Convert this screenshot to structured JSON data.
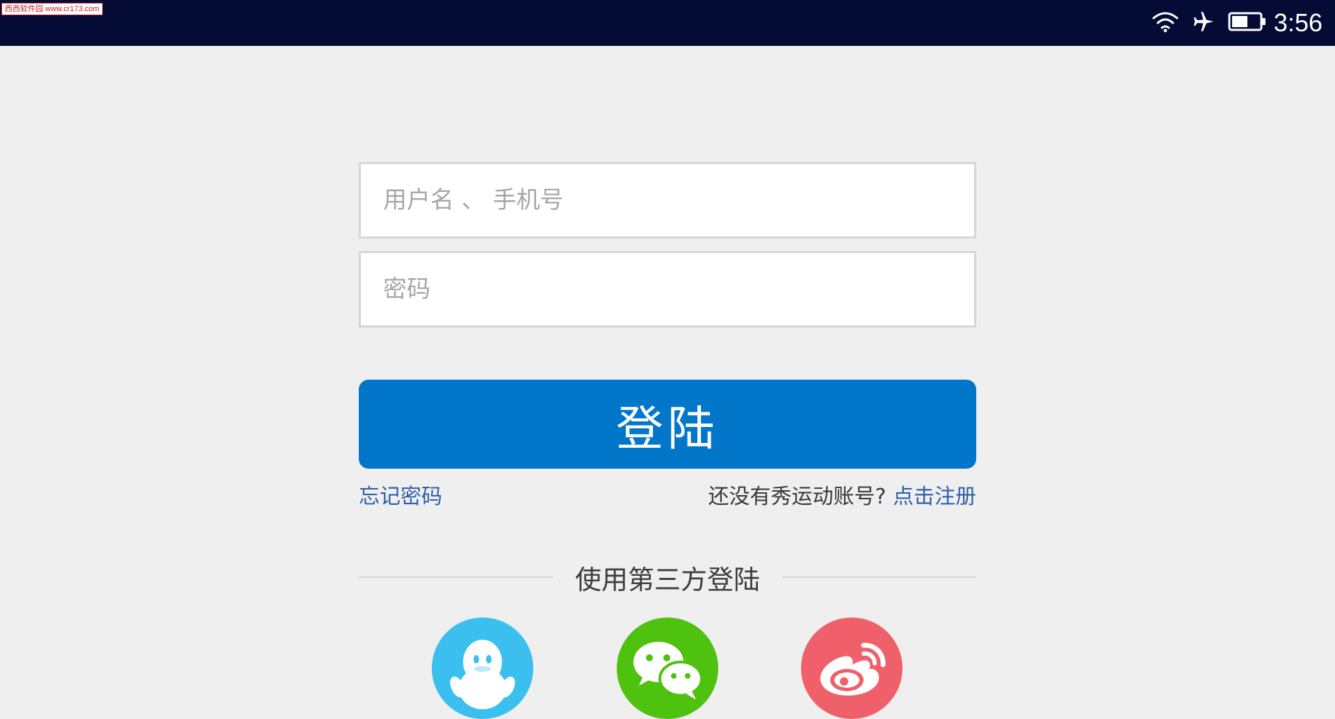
{
  "watermark": {
    "text": "西西软件园 www.cr173.com"
  },
  "status_bar": {
    "icons": [
      "wifi-icon",
      "airplane-icon",
      "battery-icon"
    ],
    "time": "3:56",
    "bg_color": "#040c36"
  },
  "login_form": {
    "username_placeholder": "用户名 、 手机号",
    "password_placeholder": "密码",
    "login_label": "登陆",
    "forgot_label": "忘记密码",
    "register_prompt": "还没有秀运动账号?",
    "register_link": "点击注册",
    "accent_color": "#0277c9"
  },
  "third_party": {
    "title": "使用第三方登陆",
    "providers": [
      {
        "icon": "qq-icon",
        "color": "#3bbfee"
      },
      {
        "icon": "wechat-icon",
        "color": "#4fc10f"
      },
      {
        "icon": "weibo-icon",
        "color": "#f0606a"
      }
    ]
  }
}
